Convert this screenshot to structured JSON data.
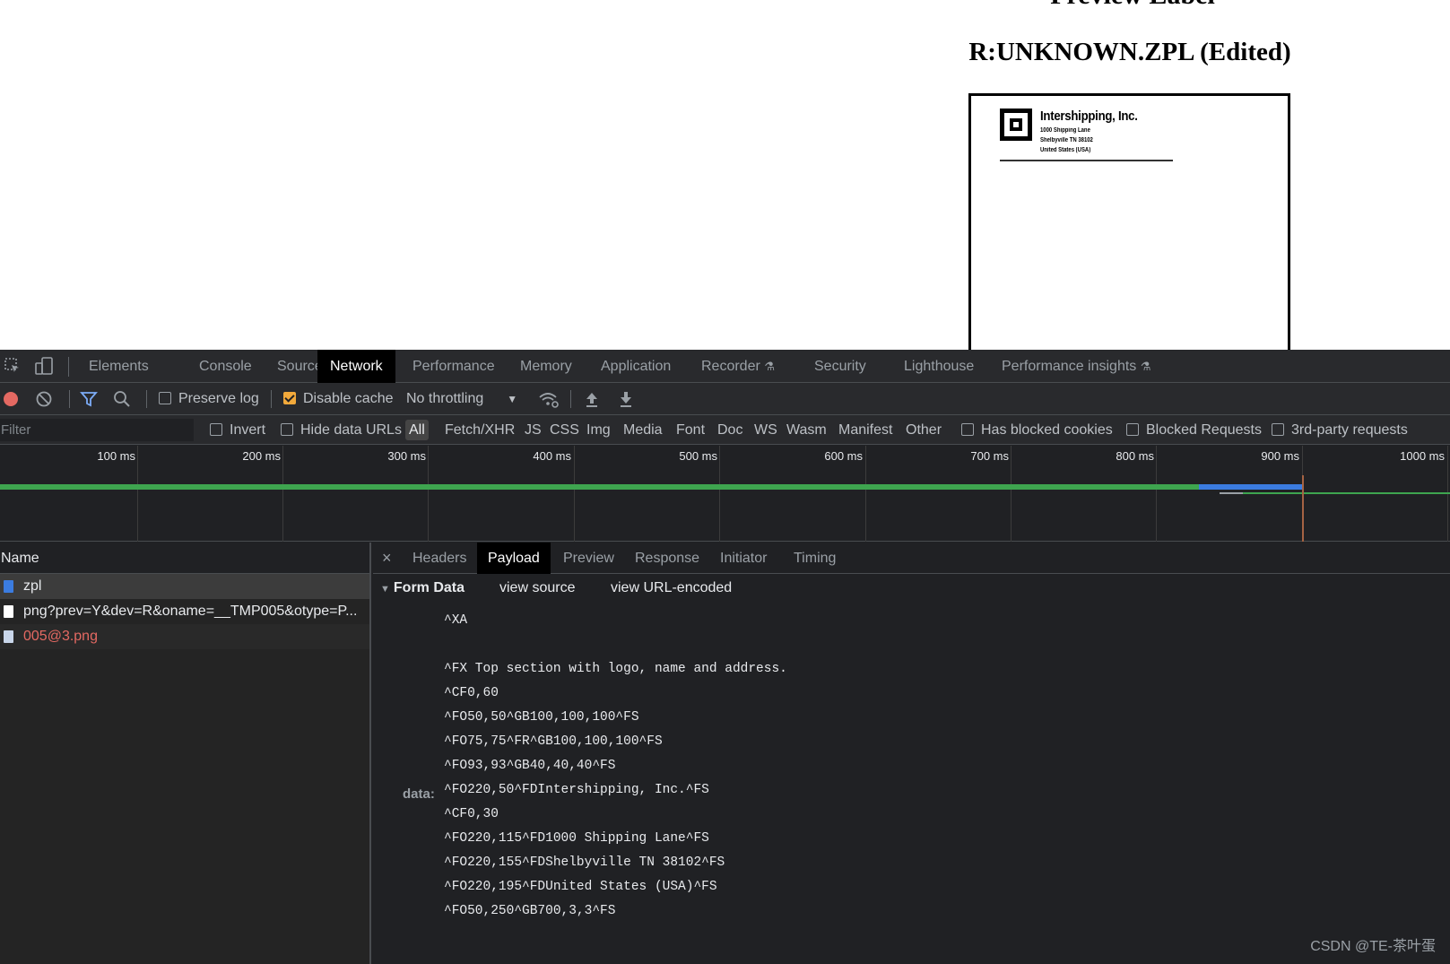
{
  "page": {
    "heading": "Preview Label",
    "subheading": "R:UNKNOWN.ZPL (Edited)",
    "label": {
      "company": "Intershipping, Inc.",
      "address_lines": [
        "1000 Shipping Lane",
        "Shelbyville TN 38102",
        "United States (USA)"
      ]
    }
  },
  "devtools": {
    "tabs": [
      "Elements",
      "Console",
      "Sources",
      "Network",
      "Performance",
      "Memory",
      "Application",
      "Recorder",
      "Security",
      "Lighthouse",
      "Performance insights"
    ],
    "active_tab": "Network",
    "toolbar": {
      "preserve_log": "Preserve log",
      "disable_cache": "Disable cache",
      "throttling": "No throttling"
    },
    "filter": {
      "placeholder": "Filter",
      "invert": "Invert",
      "hide_data_urls": "Hide data URLs",
      "types": [
        "All",
        "Fetch/XHR",
        "JS",
        "CSS",
        "Img",
        "Media",
        "Font",
        "Doc",
        "WS",
        "Wasm",
        "Manifest",
        "Other"
      ],
      "has_blocked_cookies": "Has blocked cookies",
      "blocked_requests": "Blocked Requests",
      "third_party": "3rd-party requests"
    },
    "timeline": {
      "ticks": [
        "100 ms",
        "200 ms",
        "300 ms",
        "400 ms",
        "500 ms",
        "600 ms",
        "700 ms",
        "800 ms",
        "900 ms",
        "1000 ms"
      ]
    },
    "requests": {
      "header": "Name",
      "items": [
        {
          "name": "zpl",
          "state": "selected"
        },
        {
          "name": "png?prev=Y&dev=R&oname=__TMP005&otype=P...",
          "state": "normal"
        },
        {
          "name": "005@3.png",
          "state": "error"
        }
      ]
    },
    "detail": {
      "tabs": [
        "Headers",
        "Payload",
        "Preview",
        "Response",
        "Initiator",
        "Timing"
      ],
      "active_tab": "Payload",
      "section_title": "Form Data",
      "view_source": "view source",
      "view_url_encoded": "view URL-encoded",
      "data_key": "data:",
      "data_lines": [
        "^XA",
        "",
        "^FX Top section with logo, name and address.",
        "^CF0,60",
        "^FO50,50^GB100,100,100^FS",
        "^FO75,75^FR^GB100,100,100^FS",
        "^FO93,93^GB40,40,40^FS",
        "^FO220,50^FDIntershipping, Inc.^FS",
        "^CF0,30",
        "^FO220,115^FD1000 Shipping Lane^FS",
        "^FO220,155^FDShelbyville TN 38102^FS",
        "^FO220,195^FDUnited States (USA)^FS",
        "^FO50,250^GB700,3,3^FS"
      ]
    }
  },
  "watermark": "CSDN @TE-茶叶蛋",
  "colors": {
    "devtools_bg": "#202124",
    "accent_checkbox": "#f2a93b",
    "waterfall_green": "#3ea54f",
    "waterfall_blue": "#3b7ce0",
    "error_text": "#e46962",
    "record_button": "#e46962"
  }
}
